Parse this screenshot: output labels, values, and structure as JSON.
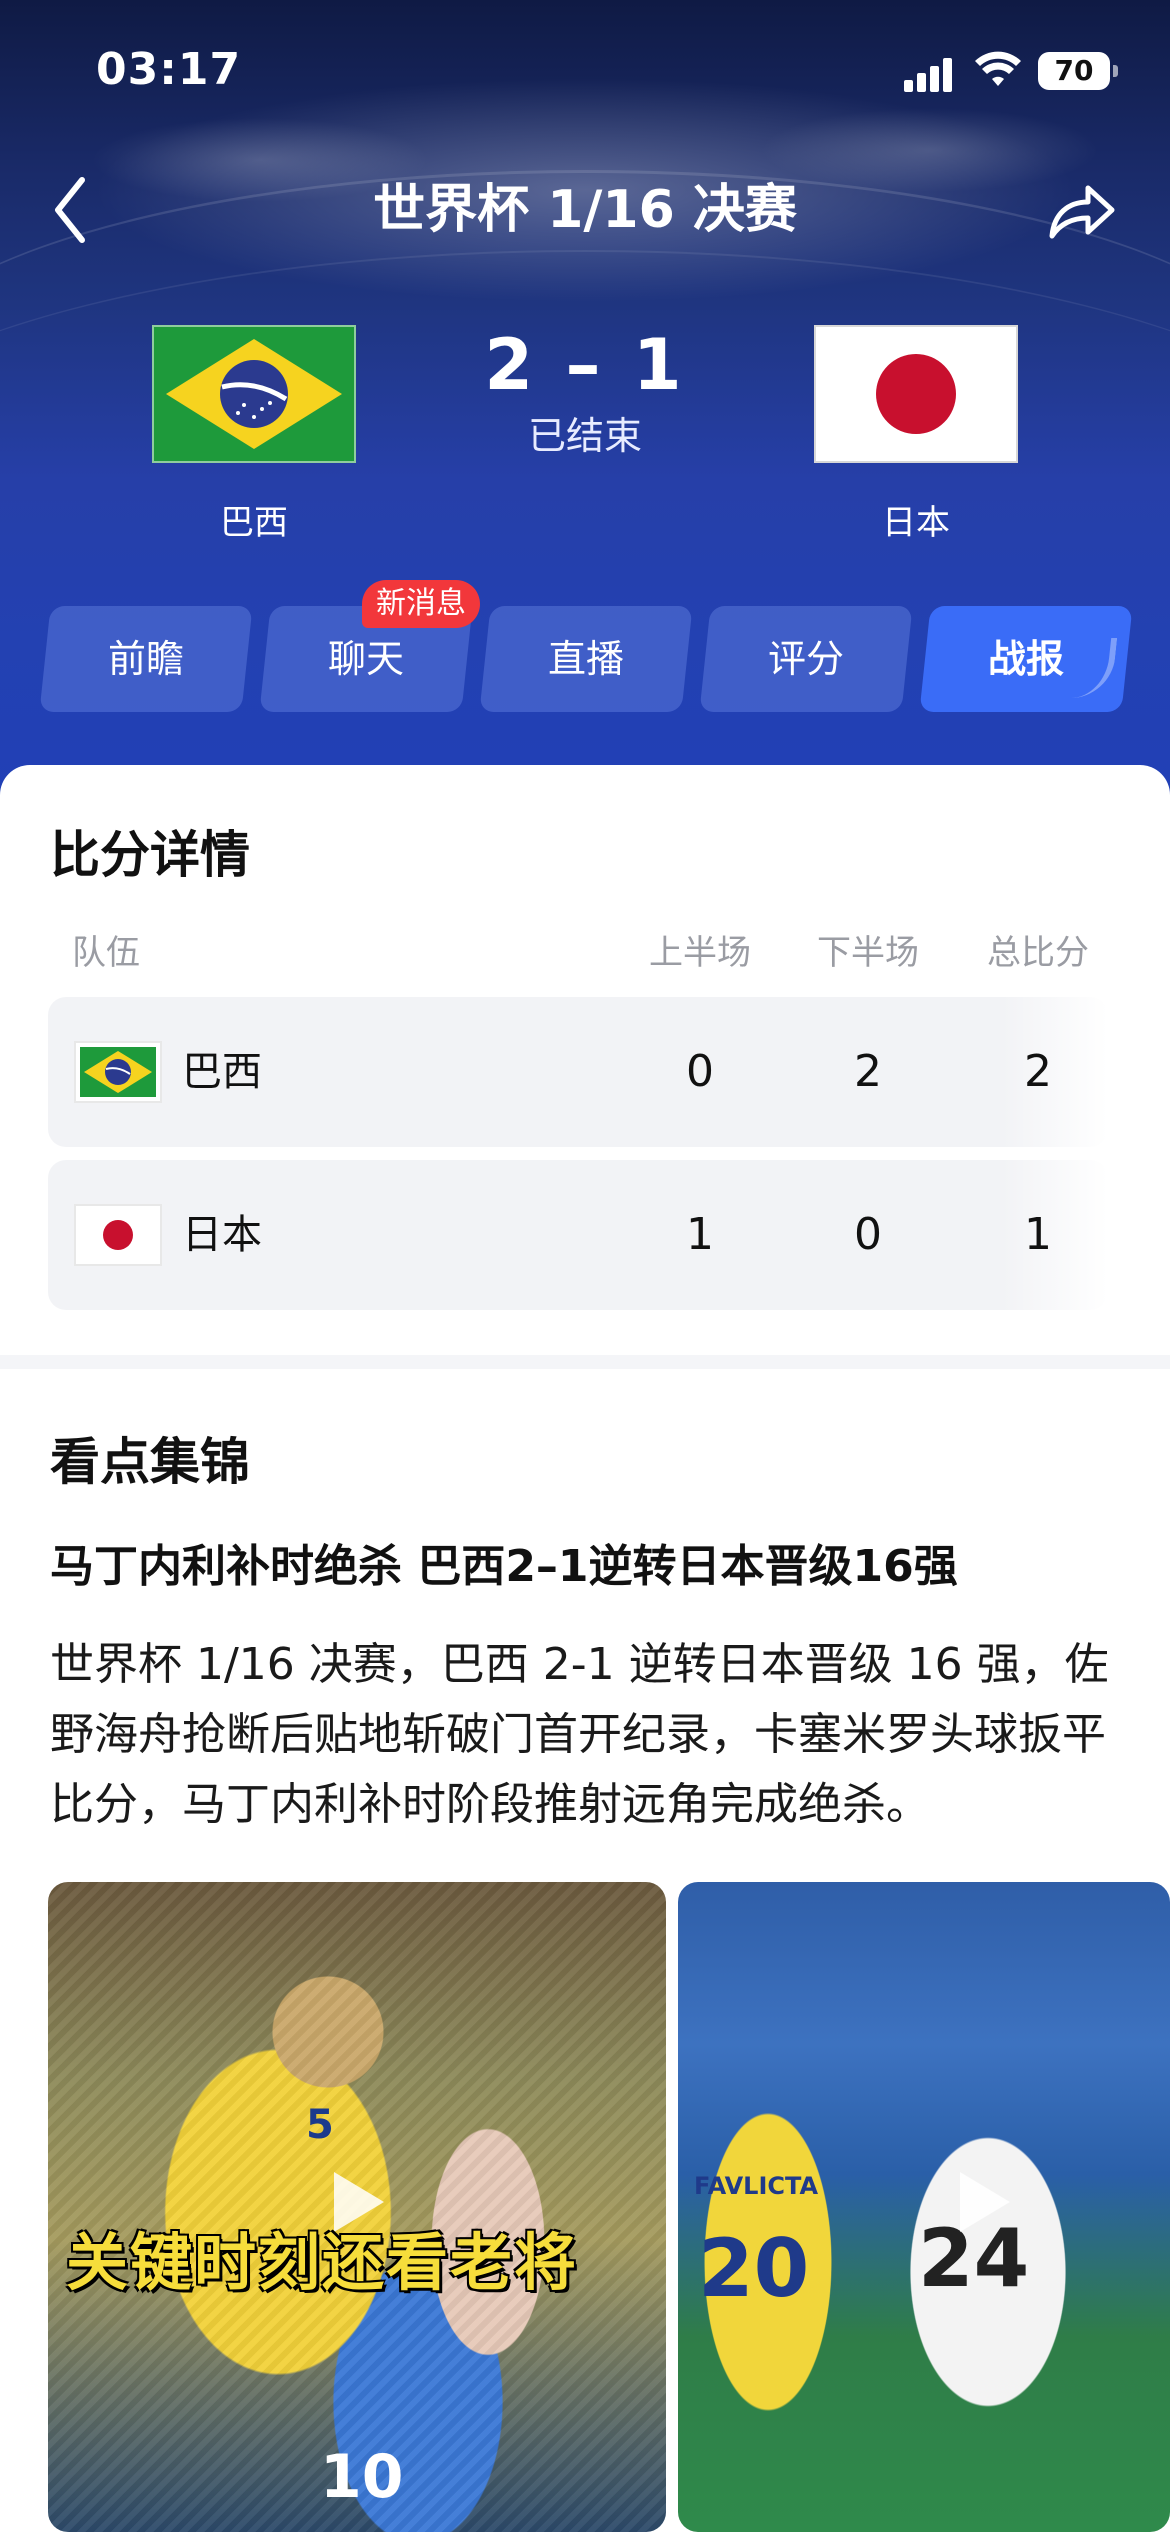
{
  "status_bar": {
    "time": "03:17",
    "battery": "70"
  },
  "nav": {
    "title": "世界杯 1/16 决赛"
  },
  "match": {
    "home": {
      "name": "巴西"
    },
    "away": {
      "name": "日本"
    },
    "score": "2 – 1",
    "status": "已结束"
  },
  "tabs": [
    {
      "label": "前瞻"
    },
    {
      "label": "聊天",
      "badge": "新消息"
    },
    {
      "label": "直播"
    },
    {
      "label": "评分"
    },
    {
      "label": "战报"
    }
  ],
  "score_detail": {
    "title": "比分详情",
    "headers": {
      "team": "队伍",
      "first_half": "上半场",
      "second_half": "下半场",
      "total": "总比分"
    },
    "rows": [
      {
        "team": "巴西",
        "first_half": "0",
        "second_half": "2",
        "total": "2"
      },
      {
        "team": "日本",
        "first_half": "1",
        "second_half": "0",
        "total": "1"
      }
    ]
  },
  "highlights": {
    "title": "看点集锦",
    "headline": "马丁内利补时绝杀 巴西2–1逆转日本晋级16强",
    "summary": "世界杯 1/16 决赛，巴西 2-1 逆转日本晋级 16 强，佐野海舟抢断后贴地斩破门首开纪录，卡塞米罗头球扳平比分，马丁内利补时阶段推射远角完成绝杀。",
    "videos": [
      {
        "caption": "关键时刻还看老将",
        "jerseys": [
          "5",
          "10"
        ]
      },
      {
        "jerseys": [
          "20",
          "24",
          "FAVLICTA"
        ]
      }
    ]
  },
  "colors": {
    "accent": "#3a6cf7",
    "badge": "#f2373b",
    "brazil_green": "#1e9a3b",
    "brazil_yellow": "#f6d31f",
    "brazil_blue": "#2b3a8f",
    "japan_red": "#c8102e"
  }
}
